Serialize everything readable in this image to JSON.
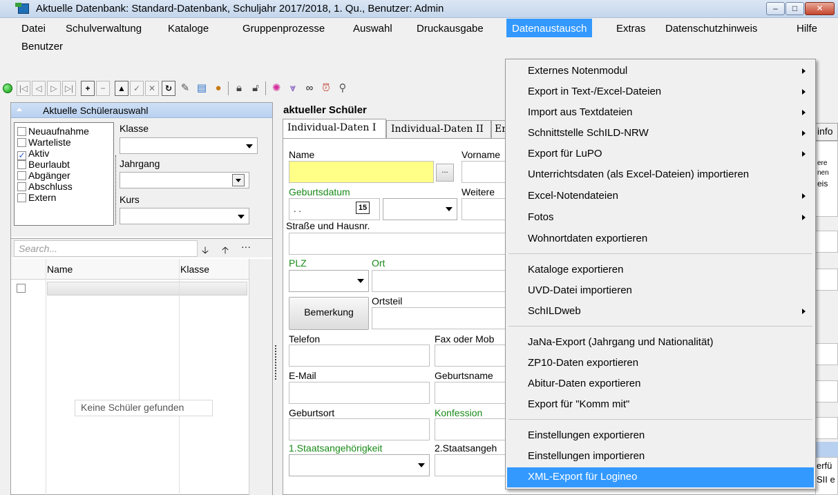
{
  "window": {
    "title": "Aktuelle Datenbank: Standard-Datenbank, Schuljahr 2017/2018, 1. Qu., Benutzer: Admin",
    "min": "–",
    "max": "□",
    "close": "✕"
  },
  "menu": {
    "datei": "Datei",
    "schulverwaltung": "Schulverwaltung",
    "kataloge": "Kataloge",
    "gruppenprozesse": "Gruppenprozesse",
    "auswahl": "Auswahl",
    "druckausgabe": "Druckausgabe",
    "datenaustausch": "Datenaustausch",
    "extras": "Extras",
    "datenschutz": "Datenschutzhinweis",
    "hilfe": "Hilfe",
    "benutzer": "Benutzer"
  },
  "toolbar": {
    "first": "|◁",
    "prev": "◁",
    "next": "▷",
    "last": "▷|",
    "add": "+",
    "remove": "−",
    "up": "▲",
    "edit": "✓",
    "cancel": "✕",
    "refresh": "↻"
  },
  "left": {
    "header": "Aktuelle Schülerauswahl",
    "status": [
      {
        "label": "Neuaufnahme",
        "checked": ""
      },
      {
        "label": "Warteliste",
        "checked": ""
      },
      {
        "label": "Aktiv",
        "checked": "✓"
      },
      {
        "label": "Beurlaubt",
        "checked": ""
      },
      {
        "label": "Abgänger",
        "checked": ""
      },
      {
        "label": "Abschluss",
        "checked": ""
      },
      {
        "label": "Extern",
        "checked": ""
      }
    ],
    "klasse": "Klasse",
    "jahrgang": "Jahrgang",
    "kurs": "Kurs",
    "search_placeholder": "Search...",
    "col_name": "Name",
    "col_klasse": "Klasse",
    "empty": "Keine Schüler gefunden"
  },
  "detail": {
    "title": "aktueller Schüler",
    "tabs": [
      "Individual-Daten I",
      "Individual-Daten II",
      "Er"
    ],
    "tab_info": "info",
    "labels": {
      "name": "Name",
      "vorname": "Vorname",
      "geburtsdatum": "Geburtsdatum",
      "weitere": "Weitere",
      "strasse": "Straße und Hausnr.",
      "plz": "PLZ",
      "ort": "Ort",
      "ortsteil": "Ortsteil",
      "telefon": "Telefon",
      "fax": "Fax oder Mob",
      "email": "E-Mail",
      "geburtsname": "Geburtsname",
      "geburtsort": "Geburtsort",
      "konfession": "Konfession",
      "staat1": "1.Staatsangehörigkeit",
      "staat2": "2.Staatsangeh"
    },
    "date_value": ". .",
    "cal": "15",
    "ellipsis": "...",
    "bemerkung": "Bemerkung",
    "strip": {
      "a": "ere",
      "b": "nen",
      "c": "eis",
      "d": "erfü",
      "e": "SII e"
    }
  },
  "dropdown": {
    "items": [
      {
        "label": "Externes Notenmodul",
        "sub": true
      },
      {
        "label": "Export in Text-/Excel-Dateien",
        "sub": true
      },
      {
        "label": "Import aus Textdateien",
        "sub": true
      },
      {
        "label": "Schnittstelle SchILD-NRW",
        "sub": true
      },
      {
        "label": "Export für LuPO",
        "sub": true
      },
      {
        "label": "Unterrichtsdaten (als Excel-Dateien) importieren",
        "sub": false
      },
      {
        "label": "Excel-Notendateien",
        "sub": true
      },
      {
        "label": "Fotos",
        "sub": true
      },
      {
        "label": "Wohnortdaten exportieren",
        "sub": false
      },
      {
        "label": "Kataloge exportieren",
        "sub": false
      },
      {
        "label": "UVD-Datei importieren",
        "sub": false
      },
      {
        "label": "SchILDweb",
        "sub": true
      },
      {
        "label": "JaNa-Export (Jahrgang und Nationalität)",
        "sub": false
      },
      {
        "label": "ZP10-Daten exportieren",
        "sub": false
      },
      {
        "label": "Abitur-Daten exportieren",
        "sub": false
      },
      {
        "label": "Export für \"Komm mit\"",
        "sub": false
      },
      {
        "label": "Einstellungen exportieren",
        "sub": false
      },
      {
        "label": "Einstellungen importieren",
        "sub": false
      },
      {
        "label": "XML-Export für Logineo",
        "sub": false
      }
    ]
  }
}
